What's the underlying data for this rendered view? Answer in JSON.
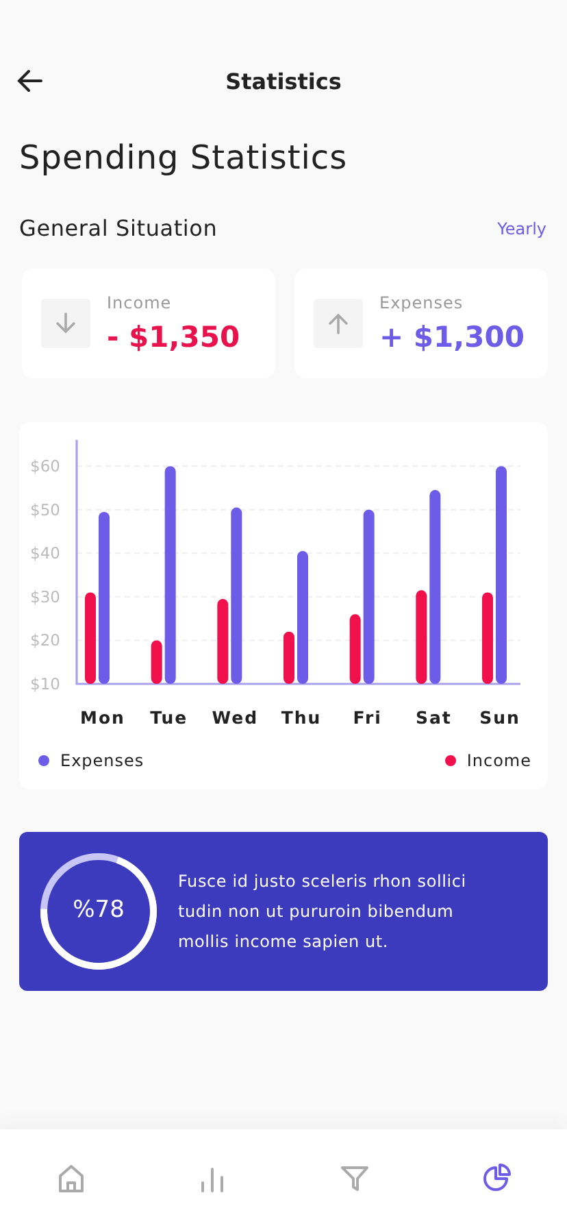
{
  "header": {
    "title": "Statistics"
  },
  "page_title": "Spending Statistics",
  "section": {
    "title": "General Situation",
    "period": "Yearly"
  },
  "summary_cards": [
    {
      "kind": "income",
      "label": "Income",
      "amount": "- $1,350"
    },
    {
      "kind": "expenses",
      "label": "Expenses",
      "amount": "+ $1,300"
    }
  ],
  "chart": {
    "chart_data": {
      "type": "bar",
      "categories": [
        "Mon",
        "Tue",
        "Wed",
        "Thu",
        "Fri",
        "Sat",
        "Sun"
      ],
      "series": [
        {
          "name": "Income",
          "color": "#f0104c",
          "values": [
            31,
            20,
            29.5,
            22,
            26,
            31.5,
            31
          ]
        },
        {
          "name": "Expenses",
          "color": "#6c5ce7",
          "values": [
            49.5,
            60,
            50.5,
            40.5,
            50,
            54.5,
            60
          ]
        }
      ],
      "ylim": [
        10,
        66
      ],
      "grid": true,
      "legend": true,
      "yticks": [
        {
          "value": 10,
          "label": "$10"
        },
        {
          "value": 20,
          "label": "$20"
        },
        {
          "value": 30,
          "label": "$30"
        },
        {
          "value": 40,
          "label": "$40"
        },
        {
          "value": 50,
          "label": "$50"
        },
        {
          "value": 60,
          "label": "$60"
        }
      ]
    }
  },
  "banner": {
    "progress_label": "%78",
    "text": "Fusce id justo sceleris rhon sollici tudin non ut pururoin bibendum mollis income sapien ut."
  },
  "nav": [
    {
      "kind": "home",
      "selected": false
    },
    {
      "kind": "stats",
      "selected": false
    },
    {
      "kind": "filter",
      "selected": false
    },
    {
      "kind": "pie",
      "selected": true
    }
  ]
}
